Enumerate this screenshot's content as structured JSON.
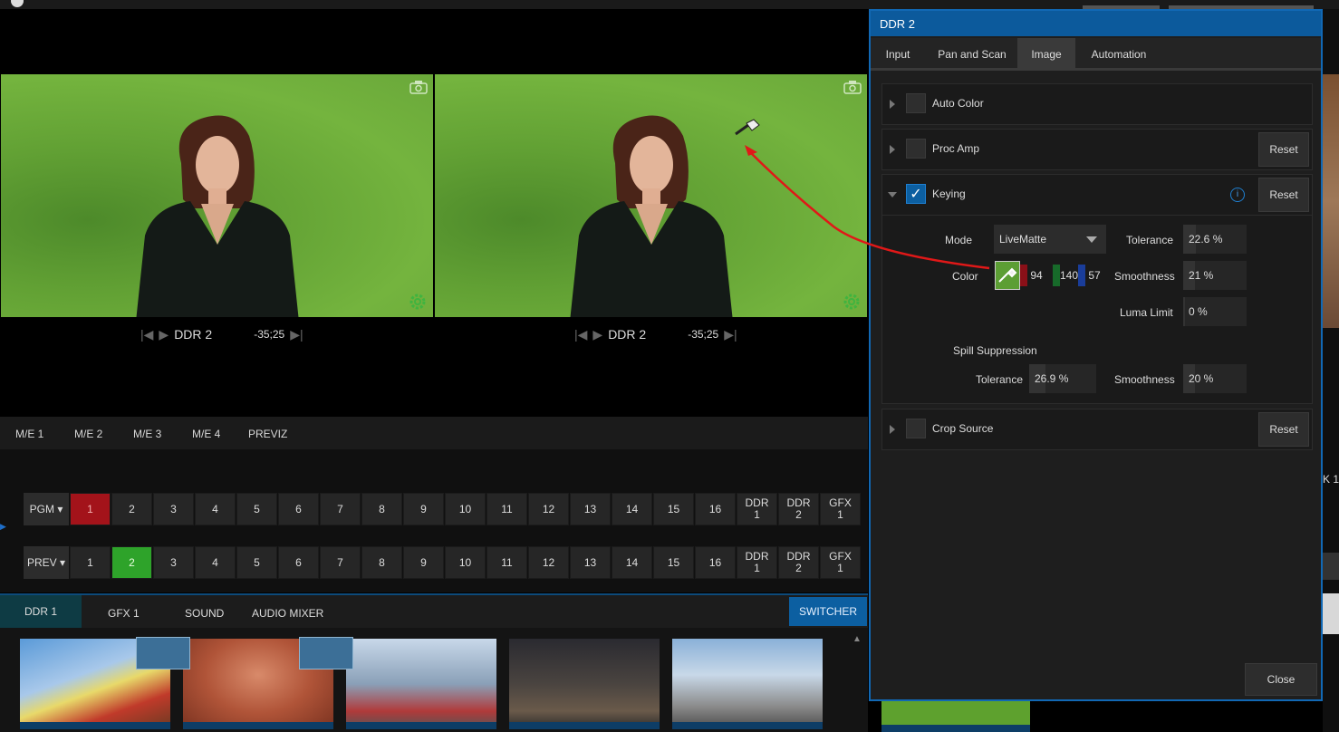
{
  "dialog": {
    "title": "DDR 2",
    "tabs": [
      {
        "label": "Input"
      },
      {
        "label": "Pan and Scan"
      },
      {
        "label": "Image"
      },
      {
        "label": "Automation"
      }
    ],
    "active_tab": "Image",
    "sections": {
      "auto_color": {
        "label": "Auto Color",
        "enabled": false
      },
      "proc_amp": {
        "label": "Proc Amp",
        "enabled": false,
        "reset_label": "Reset"
      },
      "keying": {
        "label": "Keying",
        "enabled": true,
        "reset_label": "Reset",
        "info_icon": "i"
      },
      "crop_source": {
        "label": "Crop Source",
        "enabled": false,
        "reset_label": "Reset"
      }
    },
    "keying": {
      "mode_label": "Mode",
      "mode_value": "LiveMatte",
      "color_label": "Color",
      "color_swatch": "#5c9e34",
      "color_r": "94",
      "color_g": "140",
      "color_b": "57",
      "tolerance_label": "Tolerance",
      "tolerance_value": "22.6 %",
      "smoothness_label": "Smoothness",
      "smoothness_value": "21 %",
      "luma_limit_label": "Luma Limit",
      "luma_limit_value": "0 %",
      "spill_label": "Spill Suppression",
      "spill_tolerance_label": "Tolerance",
      "spill_tolerance_value": "26.9 %",
      "spill_smoothness_label": "Smoothness",
      "spill_smoothness_value": "20 %"
    },
    "close_label": "Close"
  },
  "monitors": {
    "left": {
      "source": "DDR 2",
      "timecode": "-35;25"
    },
    "right": {
      "source": "DDR 2",
      "timecode": "-35;25"
    }
  },
  "me_tabs": [
    "M/E 1",
    "M/E 2",
    "M/E 3",
    "M/E 4",
    "PREVIZ"
  ],
  "pgm_row": {
    "label": "PGM",
    "buttons": [
      "1",
      "2",
      "3",
      "4",
      "5",
      "6",
      "7",
      "8",
      "9",
      "10",
      "11",
      "12",
      "13",
      "14",
      "15",
      "16",
      "DDR 1",
      "DDR 2",
      "GFX 1"
    ],
    "active": "1"
  },
  "prev_row": {
    "label": "PREV",
    "buttons": [
      "1",
      "2",
      "3",
      "4",
      "5",
      "6",
      "7",
      "8",
      "9",
      "10",
      "11",
      "12",
      "13",
      "14",
      "15",
      "16",
      "DDR 1",
      "DDR 2",
      "GFX 1"
    ],
    "active": "2"
  },
  "media_tabs": [
    "DDR 1",
    "GFX 1",
    "SOUND",
    "AUDIO MIXER"
  ],
  "switcher_label": "SWITCHER",
  "right_edge_label": "K 1",
  "colors": {
    "accent": "#0c5fa1",
    "pgm_red": "#a3131a",
    "prev_green": "#2ea32a",
    "chroma_green": "#6aa83a",
    "annotation_arrow": "#e01818"
  }
}
